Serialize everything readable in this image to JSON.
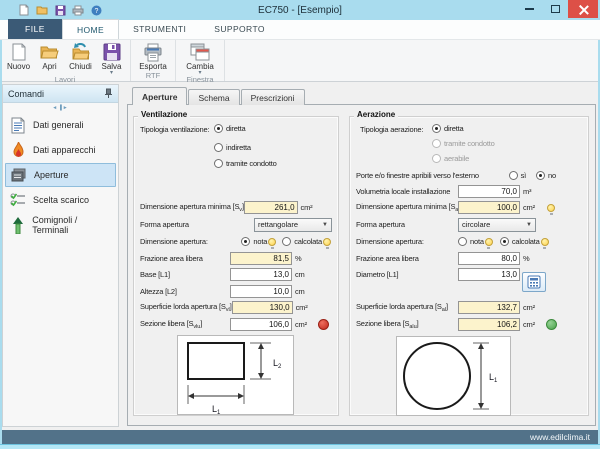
{
  "window": {
    "title": "EC750 - [Esempio]"
  },
  "ribbon": {
    "tabs": [
      {
        "label": "FILE"
      },
      {
        "label": "HOME"
      },
      {
        "label": "STRUMENTI"
      },
      {
        "label": "SUPPORTO"
      }
    ],
    "buttons": [
      {
        "label": "Nuovo"
      },
      {
        "label": "Apri"
      },
      {
        "label": "Chiudi"
      },
      {
        "label": "Salva"
      },
      {
        "label": "Esporta"
      },
      {
        "label": "Cambia"
      }
    ],
    "groups": [
      {
        "label": "Lavori"
      },
      {
        "label": "RTF"
      },
      {
        "label": "Finestra"
      }
    ]
  },
  "sidebar": {
    "header": "Comandi",
    "items": [
      {
        "label": "Dati generali"
      },
      {
        "label": "Dati apparecchi"
      },
      {
        "label": "Aperture"
      },
      {
        "label": "Scelta scarico"
      },
      {
        "label": "Comignoli / Terminali"
      }
    ]
  },
  "content_tabs": [
    {
      "label": "Aperture"
    },
    {
      "label": "Schema"
    },
    {
      "label": "Prescrizioni"
    }
  ],
  "vent": {
    "title": "Ventilazione",
    "tipologia": {
      "label": "Tipologia ventilazione:",
      "options": [
        "diretta",
        "indiretta",
        "tramite condotto"
      ],
      "selected": "diretta"
    },
    "dim_min": {
      "pre": "Dimensione apertura minima [S",
      "sub": "v",
      "post": "]",
      "value": "261,0",
      "unit": "cm²"
    },
    "forma": {
      "label": "Forma apertura",
      "value": "rettangolare"
    },
    "dimensione": {
      "label": "Dimensione apertura:",
      "options": [
        "nota",
        "calcolata"
      ],
      "selected": "nota"
    },
    "frazione": {
      "label": "Frazione area libera",
      "value": "81,5",
      "unit": "%"
    },
    "base": {
      "label": "Base [L1]",
      "value": "13,0",
      "unit": "cm"
    },
    "altezza": {
      "label": "Altezza [L2]",
      "value": "10,0",
      "unit": "cm"
    },
    "lorda": {
      "pre": "Superficie lorda apertura [S",
      "sub": "vl",
      "post": "]",
      "value": "130,0",
      "unit": "cm²"
    },
    "libera": {
      "pre": "Sezione libera [S",
      "sub": "vlu",
      "post": "]",
      "value": "106,0",
      "unit": "cm²",
      "status": "red"
    },
    "diagram": {
      "l1": {
        "main": "L",
        "sub": "1"
      },
      "l2": {
        "main": "L",
        "sub": "2"
      }
    }
  },
  "aer": {
    "title": "Aerazione",
    "tipologia": {
      "label": "Tipologia aerazione:",
      "options": [
        "diretta",
        "tramite condotto",
        "aerabile"
      ],
      "selected": "diretta",
      "disabled": [
        "tramite condotto",
        "aerabile"
      ]
    },
    "porte": {
      "label": "Porte e/o finestre apribili verso l'esterno",
      "options": [
        "sì",
        "no"
      ],
      "selected": "no"
    },
    "volumetria": {
      "label": "Volumetria locale installazione",
      "value": "70,0",
      "unit": "m³"
    },
    "dim_min": {
      "pre": "Dimensione apertura minima [S",
      "sub": "a",
      "post": "]",
      "value": "100,0",
      "unit": "cm²"
    },
    "forma": {
      "label": "Forma apertura",
      "value": "circolare"
    },
    "dimensione": {
      "label": "Dimensione apertura:",
      "options": [
        "nota",
        "calcolata"
      ],
      "selected": "calcolata"
    },
    "frazione": {
      "label": "Frazione area libera",
      "value": "80,0",
      "unit": "%"
    },
    "diametro": {
      "label": "Diametro [L1]",
      "value": "13,0",
      "unit": "cm"
    },
    "lorda": {
      "pre": "Superficie lorda apertura [S",
      "sub": "al",
      "post": "]",
      "value": "132,7",
      "unit": "cm²"
    },
    "libera": {
      "pre": "Sezione libera [S",
      "sub": "alu",
      "post": "]",
      "value": "106,2",
      "unit": "cm²",
      "status": "green"
    },
    "diagram": {
      "l1": {
        "main": "L",
        "sub": "1"
      }
    }
  },
  "statusbar": {
    "text": "www.edilclima.it"
  },
  "colors": {
    "titlebar": "#a9dcee",
    "file_tab": "#3b5a76",
    "field_yellow": "#fcf3cc",
    "status_red": "#c0281c",
    "status_green": "#4aa24a",
    "statusbar_bg": "#527289",
    "selection": "#cde4f6"
  }
}
